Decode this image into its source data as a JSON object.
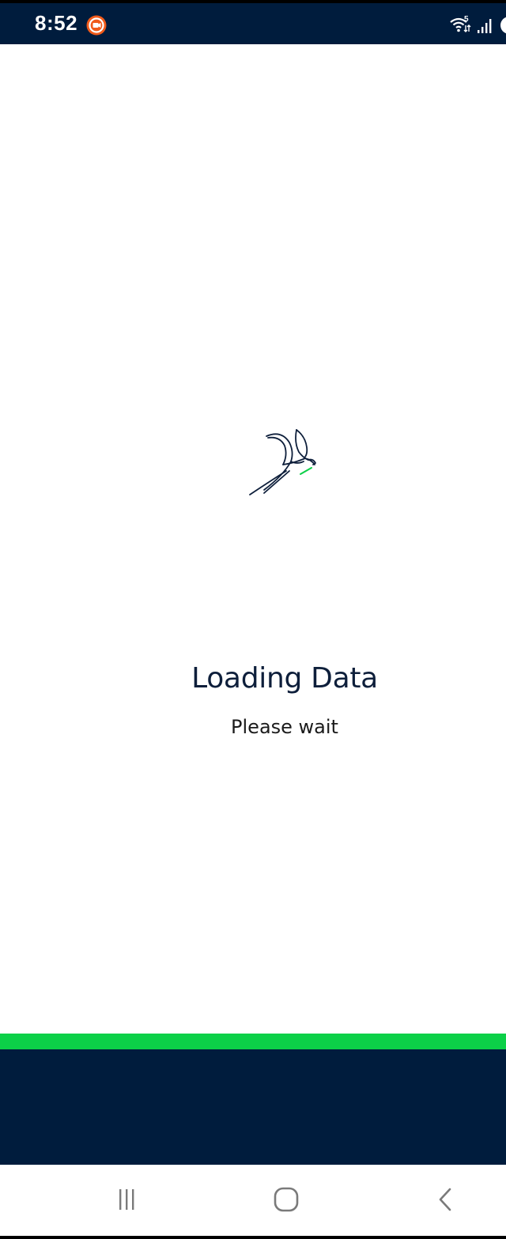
{
  "status_bar": {
    "time": "8:52",
    "wifi_badge": "5",
    "icons": [
      "screen-record-icon",
      "wifi-icon",
      "signal-icon",
      "battery-icon"
    ]
  },
  "loading": {
    "title": "Loading Data",
    "subtitle": "Please wait"
  },
  "nav_bar": {
    "buttons": [
      "recents-icon",
      "home-icon",
      "back-icon"
    ]
  },
  "colors": {
    "navy": "#001c3d",
    "accent_green": "#0cd048",
    "title_text": "#0e1f3b",
    "record_orange": "#f05a1a"
  }
}
